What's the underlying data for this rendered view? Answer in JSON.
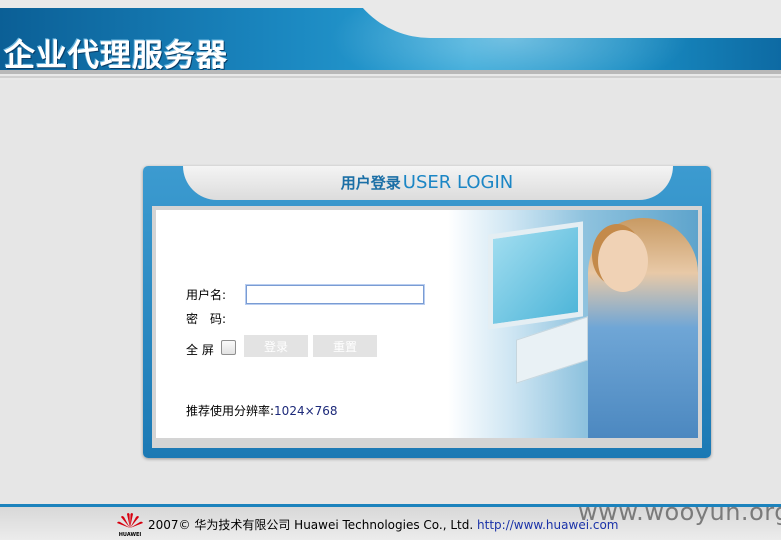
{
  "header": {
    "app_title": "企业代理服务器"
  },
  "login": {
    "title_cn": "用户登录",
    "title_en": "USER LOGIN",
    "username_label": "用户名:",
    "username_value": "",
    "password_label": "密　码:",
    "fullscreen_label": "全 屏",
    "fullscreen_checked": false,
    "login_button": "登录",
    "reset_button": "重置",
    "resolution_label": "推荐使用分辨率:",
    "resolution_value": "1024×768"
  },
  "footer": {
    "logo_text": "HUAWEI",
    "copyright": "2007© 华为技术有限公司 Huawei Technologies Co., Ltd.",
    "url": "http://www.huawei.com"
  },
  "watermark": "www.wooyun.org",
  "colors": {
    "brand_blue": "#1b79b4",
    "title_blue": "#1b6fa6",
    "footer_line": "#1c83bd",
    "huawei_red": "#d7000f"
  }
}
